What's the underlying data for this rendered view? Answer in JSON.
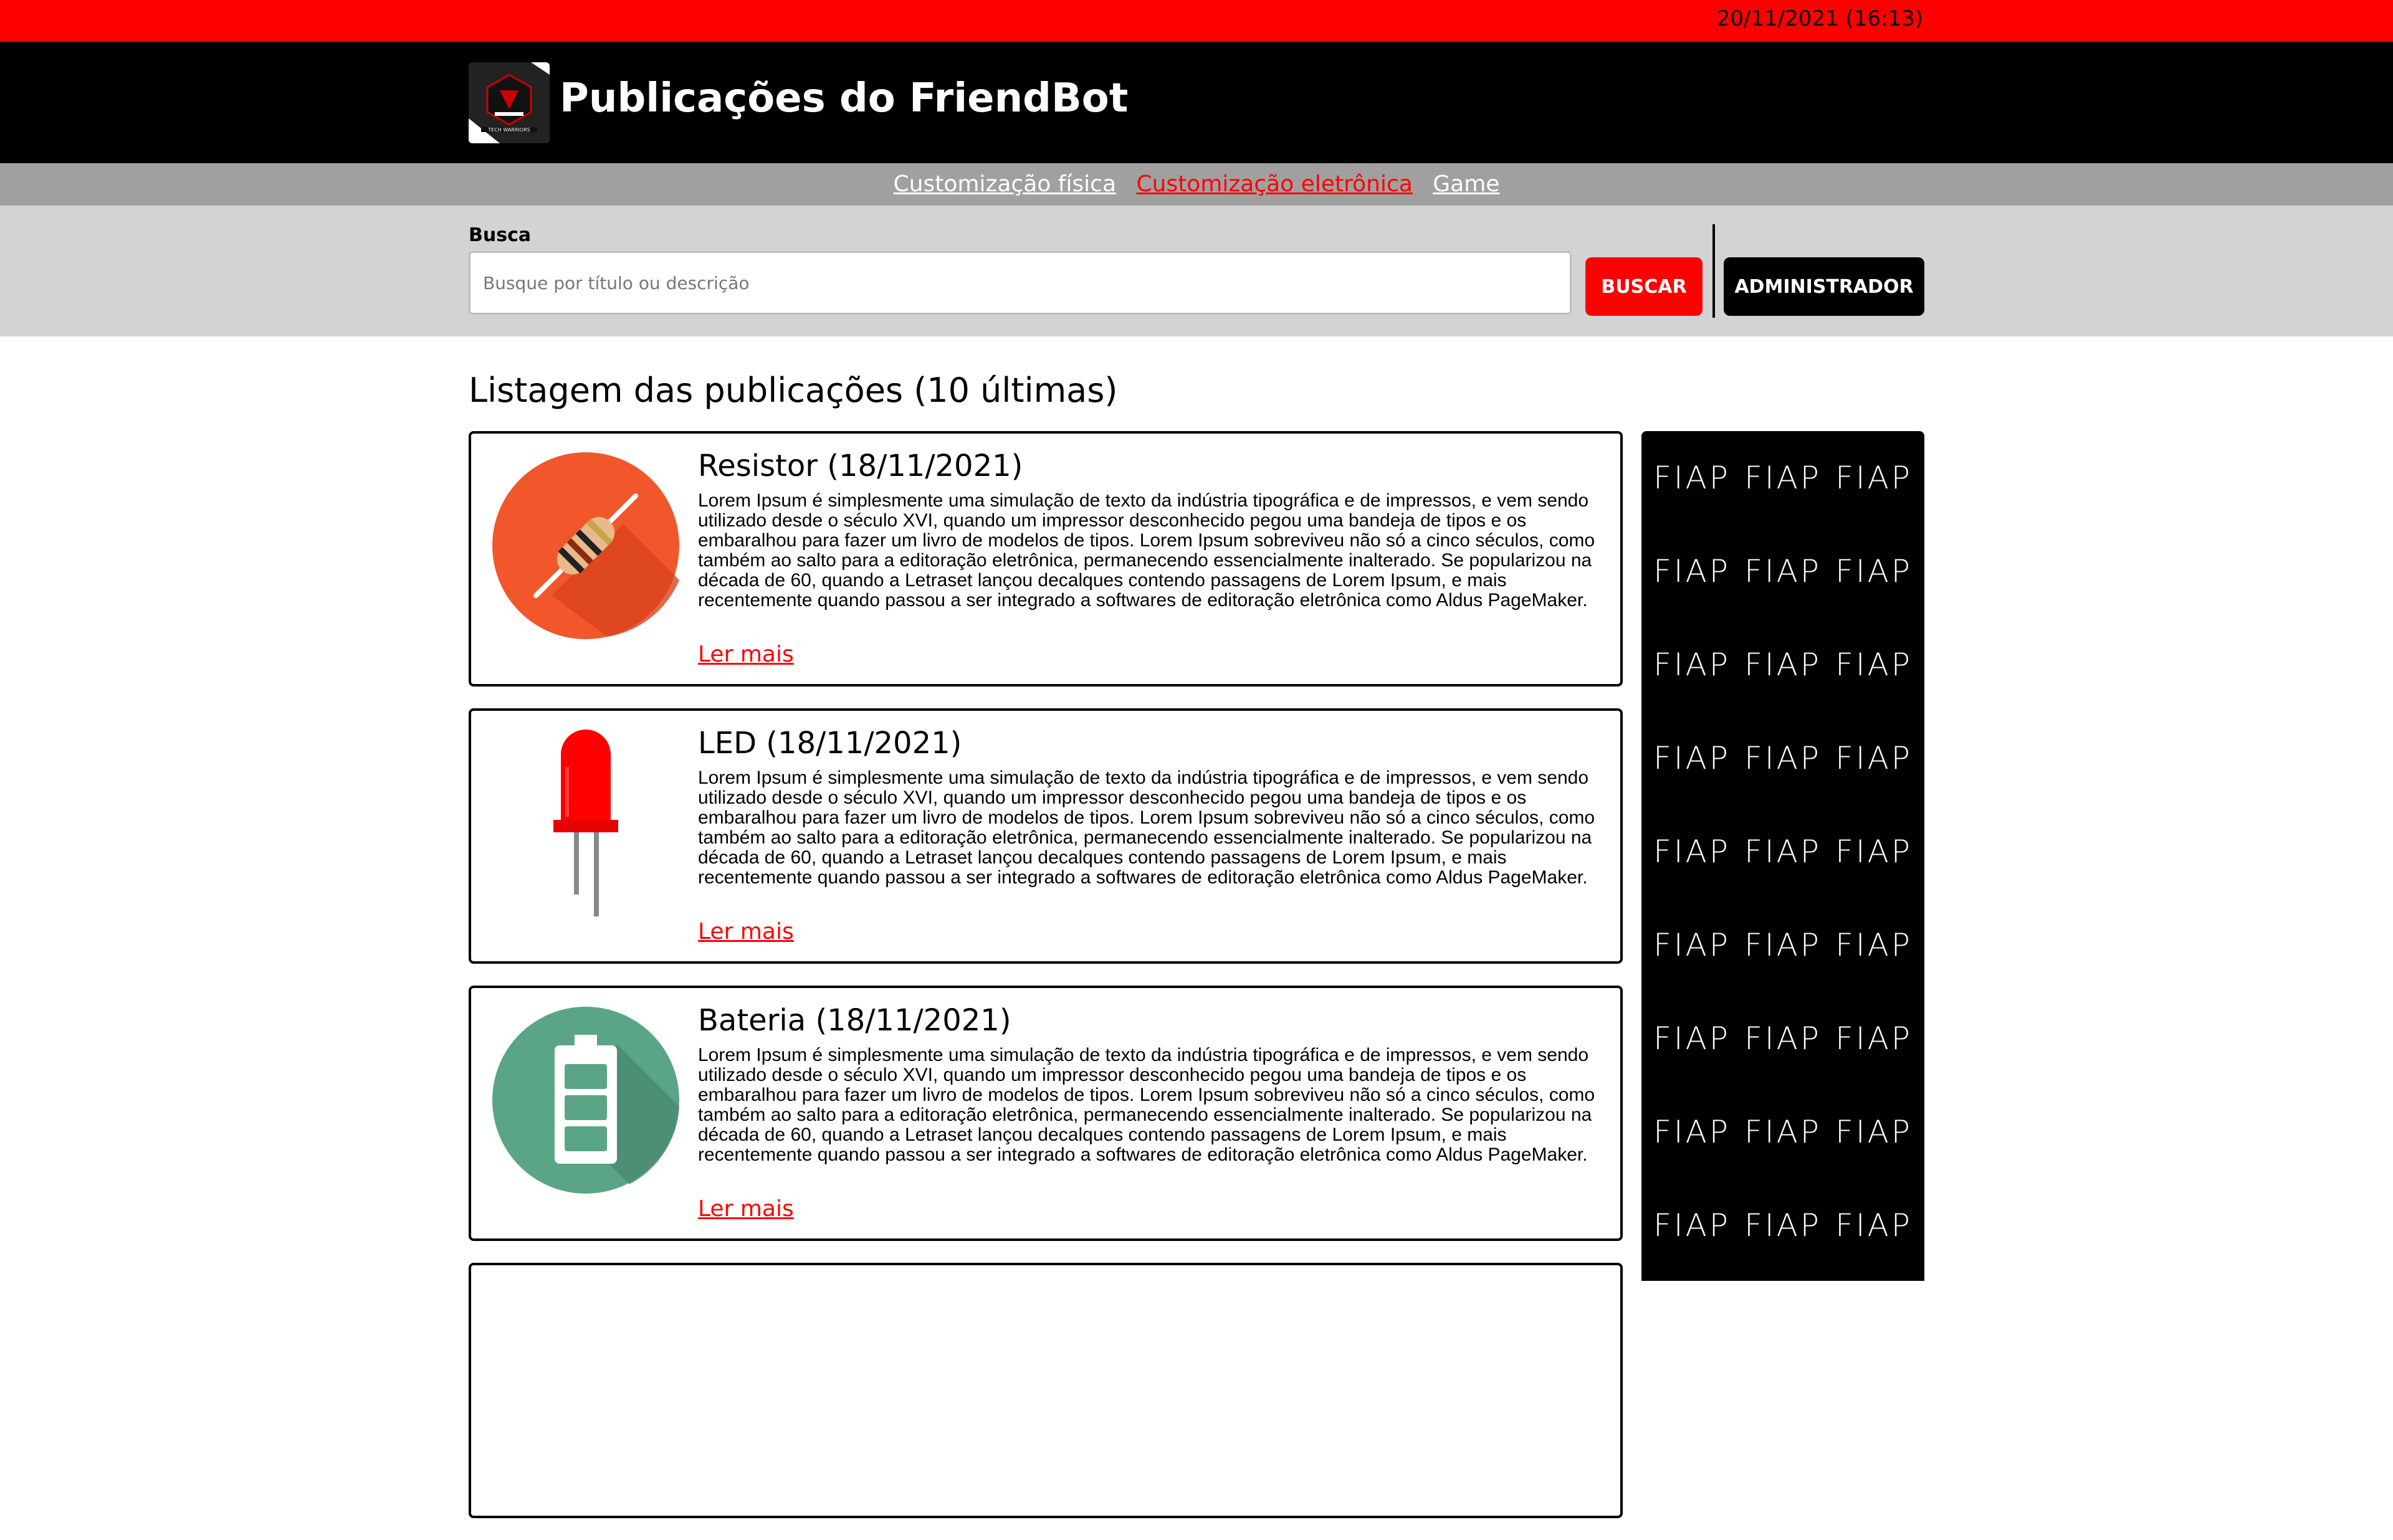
{
  "topbar": {
    "datetime": "20/11/2021 (16:13)"
  },
  "header": {
    "title": "Publicações do FriendBot",
    "logo_text": "TECH WARRIORS"
  },
  "nav": {
    "items": [
      {
        "label": "Customização física",
        "active": false
      },
      {
        "label": "Customização eletrônica",
        "active": true
      },
      {
        "label": "Game",
        "active": false
      }
    ]
  },
  "search": {
    "label": "Busca",
    "placeholder": "Busque por título ou descrição",
    "value": "",
    "button": "BUSCAR",
    "admin_button": "ADMINISTRADOR"
  },
  "list": {
    "heading": "Listagem das publicações (10 últimas)",
    "read_more": "Ler mais",
    "posts": [
      {
        "title": "Resistor (18/11/2021)",
        "icon": "resistor-icon",
        "body": "Lorem Ipsum é simplesmente uma simulação de texto da indústria tipográfica e de impressos, e vem sendo utilizado desde o século XVI, quando um impressor desconhecido pegou uma bandeja de tipos e os embaralhou para fazer um livro de modelos de tipos. Lorem Ipsum sobreviveu não só a cinco séculos, como também ao salto para a editoração eletrônica, permanecendo essencialmente inalterado. Se popularizou na década de 60, quando a Letraset lançou decalques contendo passagens de Lorem Ipsum, e mais recentemente quando passou a ser integrado a softwares de editoração eletrônica como Aldus PageMaker."
      },
      {
        "title": "LED (18/11/2021)",
        "icon": "led-icon",
        "body": "Lorem Ipsum é simplesmente uma simulação de texto da indústria tipográfica e de impressos, e vem sendo utilizado desde o século XVI, quando um impressor desconhecido pegou uma bandeja de tipos e os embaralhou para fazer um livro de modelos de tipos. Lorem Ipsum sobreviveu não só a cinco séculos, como também ao salto para a editoração eletrônica, permanecendo essencialmente inalterado. Se popularizou na década de 60, quando a Letraset lançou decalques contendo passagens de Lorem Ipsum, e mais recentemente quando passou a ser integrado a softwares de editoração eletrônica como Aldus PageMaker."
      },
      {
        "title": "Bateria (18/11/2021)",
        "icon": "battery-icon",
        "body": "Lorem Ipsum é simplesmente uma simulação de texto da indústria tipográfica e de impressos, e vem sendo utilizado desde o século XVI, quando um impressor desconhecido pegou uma bandeja de tipos e os embaralhou para fazer um livro de modelos de tipos. Lorem Ipsum sobreviveu não só a cinco séculos, como também ao salto para a editoração eletrônica, permanecendo essencialmente inalterado. Se popularizou na década de 60, quando a Letraset lançou decalques contendo passagens de Lorem Ipsum, e mais recentemente quando passou a ser integrado a softwares de editoração eletrônica como Aldus PageMaker."
      }
    ]
  },
  "ad": {
    "brand": "FIAP"
  },
  "colors": {
    "accent": "#ff0000",
    "header_bg": "#000000",
    "nav_bg": "#a0a0a0",
    "search_bg": "#d3d3d3"
  }
}
